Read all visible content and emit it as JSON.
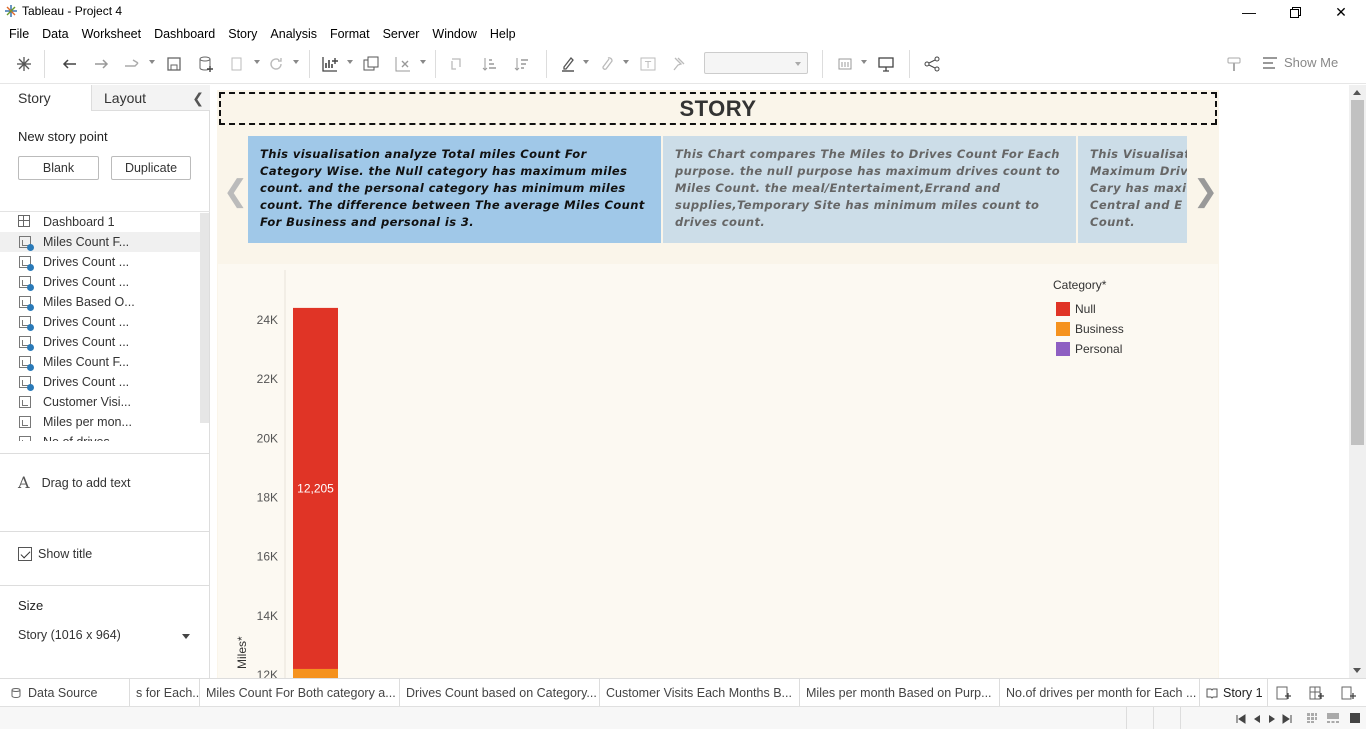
{
  "window": {
    "title": "Tableau - Project 4"
  },
  "menu": [
    "File",
    "Data",
    "Worksheet",
    "Dashboard",
    "Story",
    "Analysis",
    "Format",
    "Server",
    "Window",
    "Help"
  ],
  "toolbar": {
    "show_me": "Show Me"
  },
  "left_pane": {
    "tabs": {
      "story": "Story",
      "layout": "Layout"
    },
    "new_story_point": "New story point",
    "blank": "Blank",
    "duplicate": "Duplicate",
    "sheets": [
      {
        "label": "Dashboard 1",
        "type": "dashboard",
        "used": false
      },
      {
        "label": "Miles Count F...",
        "type": "sheet",
        "used": true
      },
      {
        "label": "Drives Count ...",
        "type": "sheet",
        "used": true
      },
      {
        "label": "Drives Count ...",
        "type": "sheet",
        "used": true
      },
      {
        "label": "Miles Based O...",
        "type": "sheet",
        "used": true
      },
      {
        "label": "Drives Count ...",
        "type": "sheet",
        "used": true
      },
      {
        "label": "Drives Count ...",
        "type": "sheet",
        "used": true
      },
      {
        "label": "Miles Count F...",
        "type": "sheet",
        "used": true
      },
      {
        "label": "Drives Count ...",
        "type": "sheet",
        "used": true
      },
      {
        "label": "Customer Visi...",
        "type": "sheet",
        "used": false
      },
      {
        "label": "Miles per mon...",
        "type": "sheet",
        "used": false
      },
      {
        "label": "No.of drives...",
        "type": "sheet",
        "used": false
      }
    ],
    "drag_text": "Drag to add text",
    "show_title": "Show title",
    "size_label": "Size",
    "size_value": "Story (1016 x 964)"
  },
  "story": {
    "title": "STORY",
    "captions": [
      "This visualisation analyze Total miles Count For Category Wise. the Null category has maximum miles count. and the personal category has minimum miles count. The difference between The average Miles Count For Business and personal is 3.",
      "This Chart compares The Miles to Drives Count For Each purpose. the null purpose has maximum drives count to Miles Count. the meal/Entertaiment,Errand and supplies,Temporary Site has minimum miles count to drives count.",
      "This Visualisat\nMaximum Driv\nCary has maxi\nCentral and E\nCount."
    ]
  },
  "chart_data": {
    "type": "bar",
    "ylabel": "Miles*",
    "y_ticks": [
      "24K",
      "22K",
      "20K",
      "18K",
      "16K",
      "14K",
      "12K"
    ],
    "ylim": [
      12000,
      24500
    ],
    "categories": [
      ""
    ],
    "series": [
      {
        "name": "Null",
        "color": "#e03426",
        "values": [
          12205
        ],
        "label": "12,205"
      },
      {
        "name": "Business",
        "color": "#f5921e",
        "values": [
          12204
        ]
      },
      {
        "name": "Personal",
        "color": "#8e5fc2",
        "values": [
          0
        ]
      }
    ],
    "stacked_total": 24409,
    "legend": {
      "title": "Category*",
      "position": "top-right"
    }
  },
  "bottom_tabs": [
    {
      "label": "Data Source"
    },
    {
      "label": "s for  Each..."
    },
    {
      "label": "Miles Count For Both category a..."
    },
    {
      "label": "Drives Count based on Category..."
    },
    {
      "label": "Customer Visits Each Months B..."
    },
    {
      "label": "Miles per month Based on Purp..."
    },
    {
      "label": "No.of drives per month for Each ..."
    },
    {
      "label": "Story 1"
    }
  ]
}
